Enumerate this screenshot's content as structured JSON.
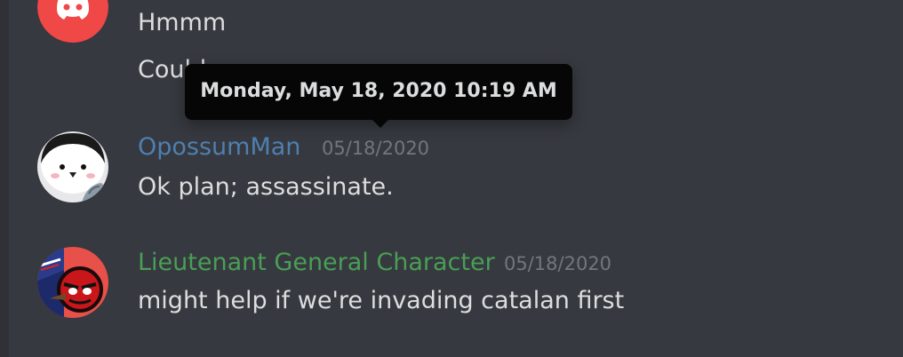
{
  "colors": {
    "background": "#36393f",
    "username_opossum": "#4f7fb0",
    "username_lieutenant": "#4a9e55",
    "timestamp": "#72767d",
    "message_text": "#dcddde",
    "tooltip_bg": "#060607",
    "discord_red": "#f04747"
  },
  "messages": [
    {
      "avatar_icon": "discord-logo-icon",
      "lines": [
        "Hmmm",
        "Could we"
      ]
    },
    {
      "author": "OpossumMan",
      "timestamp": "05/18/2020",
      "avatar_icon": "white-bird-avatar-icon",
      "text": "Ok plan; assassinate."
    },
    {
      "author": "Lieutenant General Character",
      "timestamp": "05/18/2020",
      "avatar_icon": "red-flag-character-avatar-icon",
      "text": "might help if we're invading catalan first"
    }
  ],
  "tooltip": {
    "text": "Monday, May 18, 2020 10:19 AM"
  }
}
